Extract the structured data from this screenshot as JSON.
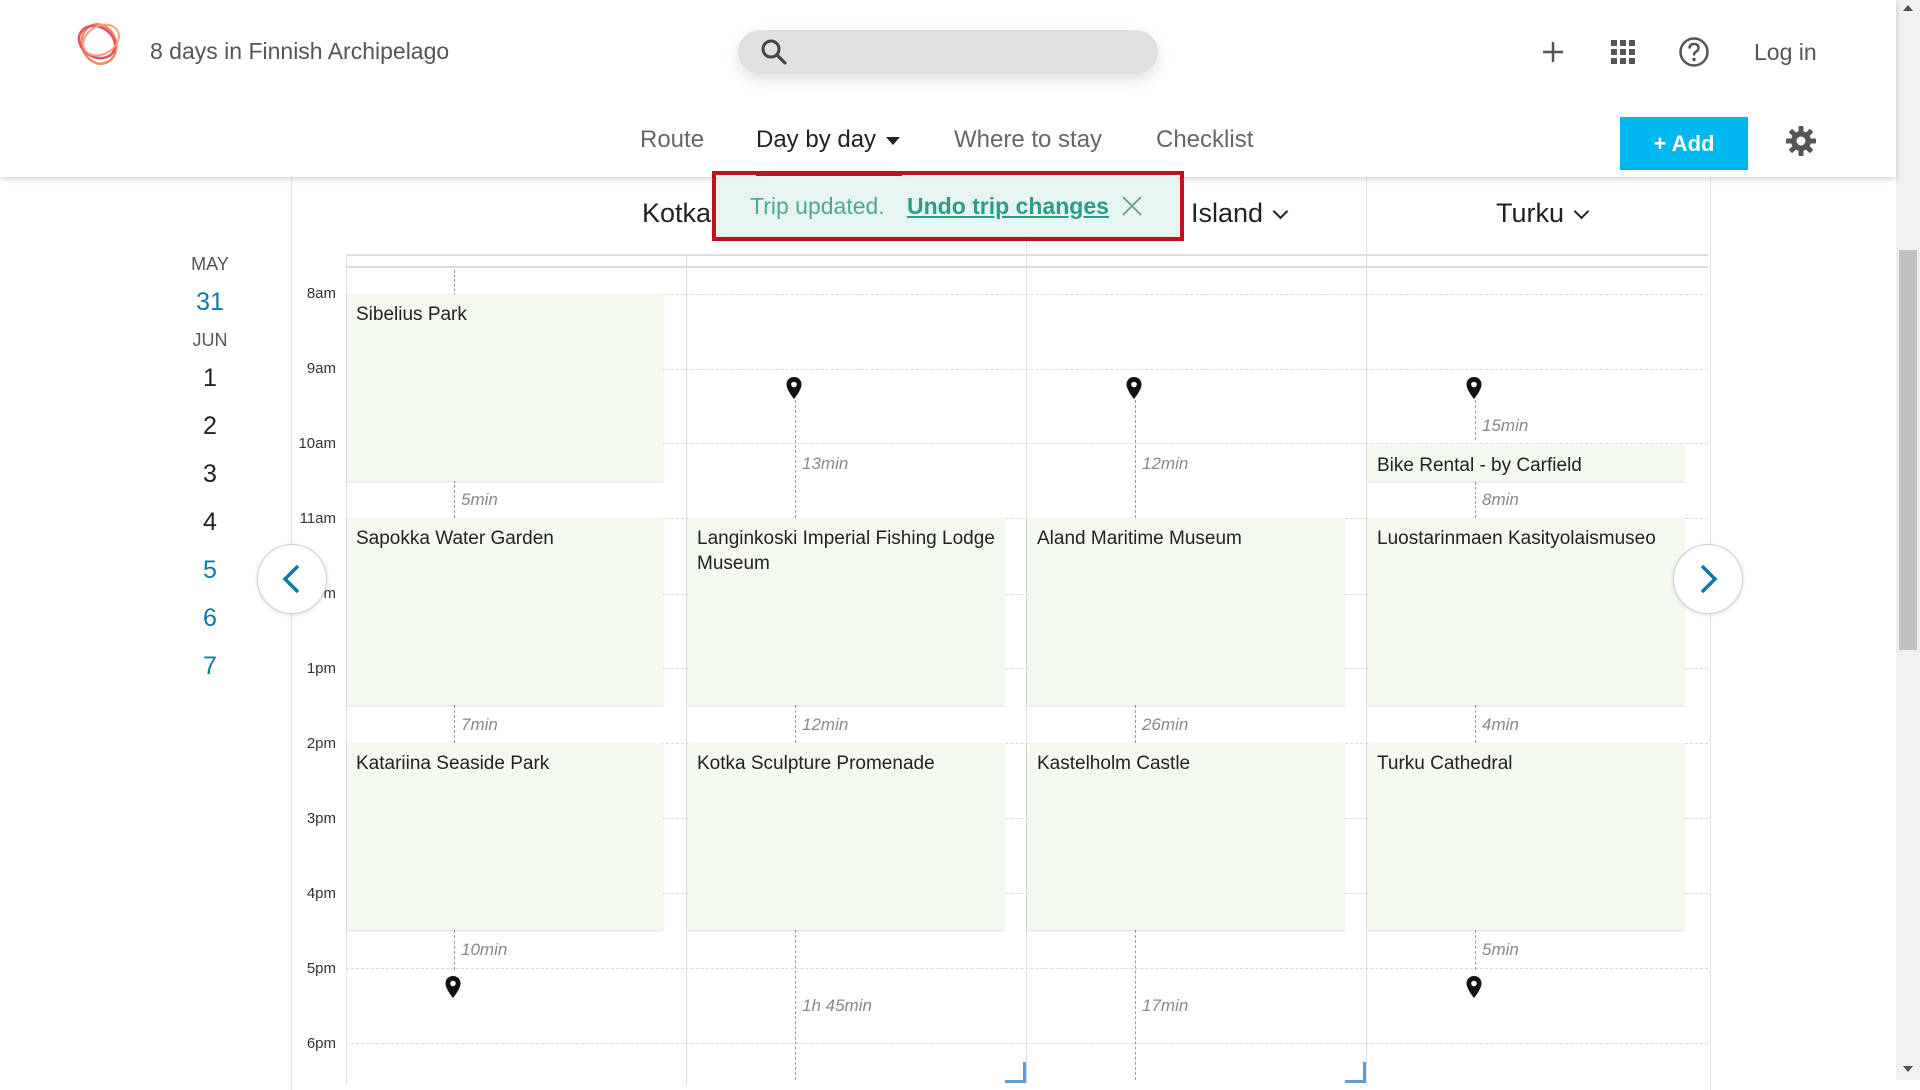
{
  "app": {
    "trip_title": "8 days in Finnish Archipelago",
    "search_placeholder": "",
    "login_label": "Log in",
    "accent_color": "#00b8ef",
    "icons": [
      "logo-icon",
      "search-icon",
      "plus-icon",
      "apps-grid-icon",
      "help-icon",
      "gear-icon"
    ]
  },
  "tabs": [
    {
      "label": "Route",
      "active": false
    },
    {
      "label": "Day by day",
      "active": true
    },
    {
      "label": "Where to stay",
      "active": false
    },
    {
      "label": "Checklist",
      "active": false
    }
  ],
  "add_button_label": "+ Add",
  "toast": {
    "message": "Trip updated.",
    "undo_label": "Undo trip changes"
  },
  "dates": {
    "month1": "MAY",
    "month2": "JUN",
    "days_may": [
      "31"
    ],
    "days_jun": [
      "1",
      "2",
      "3",
      "4",
      "5",
      "6",
      "7"
    ]
  },
  "columns": [
    {
      "title": "Kotka"
    },
    {
      "title": ""
    },
    {
      "title": "Island"
    },
    {
      "title": "Turku"
    }
  ],
  "hours": [
    "8am",
    "9am",
    "10am",
    "11am",
    "12pm",
    "1pm",
    "2pm",
    "3pm",
    "4pm",
    "5pm",
    "6pm"
  ],
  "events": {
    "col1": [
      "Sibelius Park",
      "Sapokka Water Garden",
      "Katariina Seaside Park"
    ],
    "col2": [
      "Langinkoski Imperial Fishing Lodge Museum",
      "Kotka Sculpture Promenade"
    ],
    "col3": [
      "Aland Maritime Museum",
      "Kastelholm Castle"
    ],
    "col4": [
      "Bike Rental - by Carfield",
      "Luostarinmaen Kasityolaismuseo",
      "Turku Cathedral"
    ]
  },
  "travel_times": {
    "col1": [
      "5min",
      "7min",
      "10min"
    ],
    "col2": [
      "13min",
      "12min",
      "1h 45min"
    ],
    "col3": [
      "12min",
      "26min",
      "17min"
    ],
    "col4": [
      "15min",
      "8min",
      "4min",
      "5min"
    ]
  }
}
